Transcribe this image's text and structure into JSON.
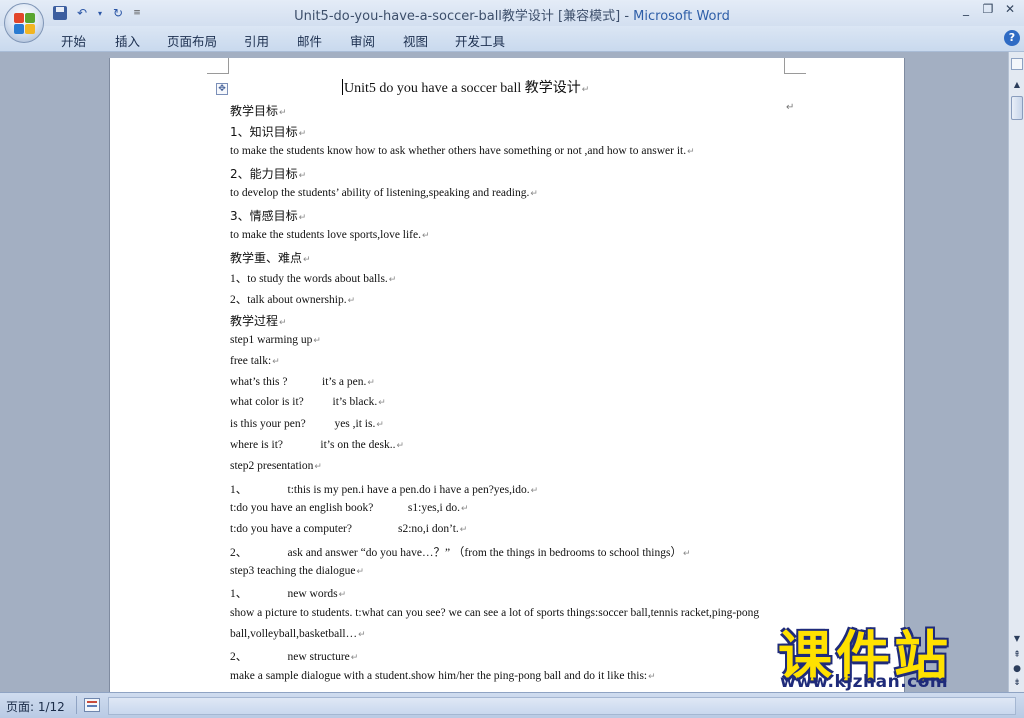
{
  "window": {
    "title_doc": "Unit5-do-you-have-a-soccer-ball教学设计 [兼容模式]",
    "title_sep": " - ",
    "title_app": "Microsoft Word",
    "qat_icons": [
      "save-icon",
      "undo-icon",
      "redo-icon",
      "customize-icon"
    ]
  },
  "ribbon": {
    "tabs": [
      "开始",
      "插入",
      "页面布局",
      "引用",
      "邮件",
      "审阅",
      "视图",
      "开发工具"
    ]
  },
  "document": {
    "title": "Unit5 do you have a soccer ball 教学设计",
    "lines": [
      "教学目标",
      "1、知识目标",
      "to make the students know how to ask whether others have something or not ,and how to answer it.",
      "2、能力目标",
      "to develop the students’ ability of listening,speaking and reading.",
      "3、情感目标",
      "to make the students love sports,love life.",
      "教学重、难点",
      "1、to study the words about balls.",
      "2、talk about ownership.",
      "教学过程",
      "step1 warming up",
      "free talk:",
      "what’s this ?            it’s a pen.",
      "what color is it?          it’s black.",
      "is this your pen?          yes ,it is.",
      "where is it?             it’s on the desk..",
      "step2 presentation",
      "1、              t:this is my pen.i have a pen.do i have a pen?yes,ido.",
      "t:do you have an english book?            s1:yes,i do.",
      "t:do you have a computer?                s2:no,i don’t.",
      "2、              ask and answer “do you have…？” （from the things in bedrooms to school things）",
      "step3 teaching the dialogue",
      "1、              new words",
      "show a picture to students. t:what can you see? we can see a lot of sports things:soccer ball,tennis racket,ping-pong",
      "ball,volleyball,basketball…",
      "2、              new structure",
      "make a sample dialogue with a student.show him/her the ping-pong ball and do it like this:"
    ]
  },
  "status": {
    "page_info": "页面: 1/12"
  },
  "watermark": {
    "cn": "课件站",
    "url": "www.kjzhan.com"
  },
  "colors": {
    "title_app": "#2e5ea8",
    "watermark_yellow": "#ffe100",
    "watermark_blue": "#1f2b7a"
  }
}
